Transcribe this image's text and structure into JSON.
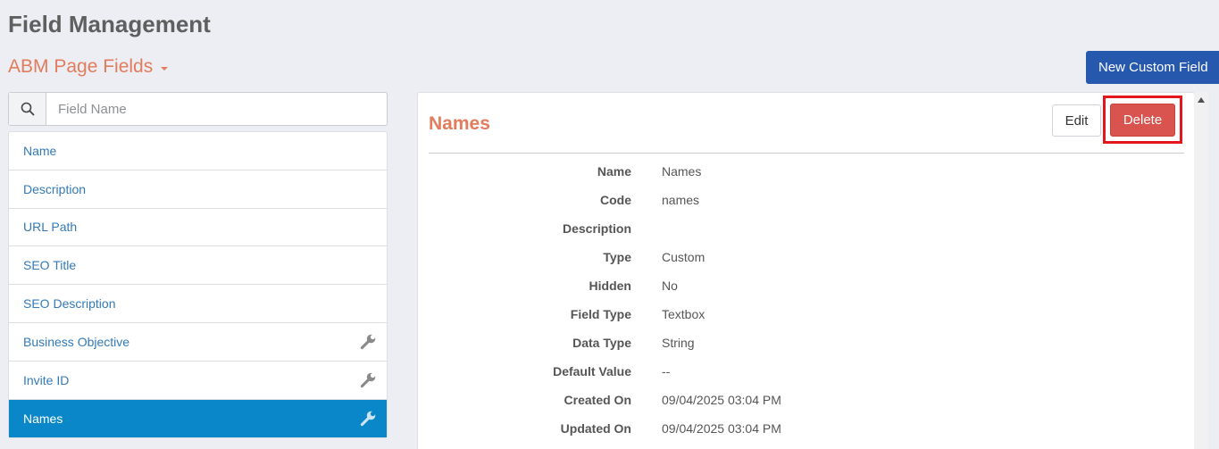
{
  "page": {
    "title": "Field Management",
    "section": "ABM Page Fields",
    "new_button": "New Custom Field"
  },
  "search": {
    "placeholder": "Field Name",
    "value": ""
  },
  "fields": [
    {
      "label": "Name",
      "custom": false,
      "active": false
    },
    {
      "label": "Description",
      "custom": false,
      "active": false
    },
    {
      "label": "URL Path",
      "custom": false,
      "active": false
    },
    {
      "label": "SEO Title",
      "custom": false,
      "active": false
    },
    {
      "label": "SEO Description",
      "custom": false,
      "active": false
    },
    {
      "label": "Business Objective",
      "custom": true,
      "active": false
    },
    {
      "label": "Invite ID",
      "custom": true,
      "active": false
    },
    {
      "label": "Names",
      "custom": true,
      "active": true
    }
  ],
  "detail": {
    "title": "Names",
    "edit_label": "Edit",
    "delete_label": "Delete",
    "properties": [
      {
        "label": "Name",
        "value": "Names"
      },
      {
        "label": "Code",
        "value": "names"
      },
      {
        "label": "Description",
        "value": ""
      },
      {
        "label": "Type",
        "value": "Custom"
      },
      {
        "label": "Hidden",
        "value": "No"
      },
      {
        "label": "Field Type",
        "value": "Textbox"
      },
      {
        "label": "Data Type",
        "value": "String"
      },
      {
        "label": "Default Value",
        "value": "--"
      },
      {
        "label": "Created On",
        "value": "09/04/2025 03:04 PM"
      },
      {
        "label": "Updated On",
        "value": "09/04/2025 03:04 PM"
      }
    ]
  },
  "colors": {
    "accent": "#e27c5c",
    "primary": "#2659ad",
    "active_item": "#0a87c9",
    "danger": "#d9534f",
    "highlight": "#e3151d"
  }
}
